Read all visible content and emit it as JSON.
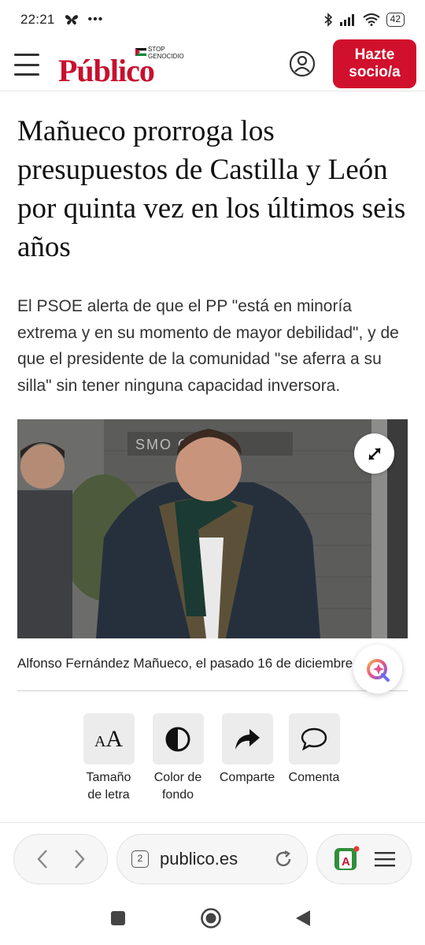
{
  "status_bar": {
    "time": "22:21",
    "battery": "42"
  },
  "header": {
    "brand": "Público",
    "stop_badge_line1": "STOP",
    "stop_badge_line2": "GENOCIDIO",
    "cta_line1": "Hazte",
    "cta_line2": "socio/a",
    "accent_color": "#d0102c"
  },
  "article": {
    "headline": "Mañueco prorroga los presupuestos de Castilla y León por quinta vez en los últimos seis años",
    "subtitle": "El PSOE alerta de que el PP \"está en minoría extrema y en su momento de mayor debilidad\", y de que el presidente de la comunidad \"se aferra a su silla\" sin tener ninguna capacidad inversora.",
    "photo_sign": "SMO   OOM",
    "caption": "Alfonso Fernández Mañueco, el pasado 16 de diciembre"
  },
  "actions": [
    {
      "label_line1": "Tamaño",
      "label_line2": "de letra",
      "icon": "text-size-icon"
    },
    {
      "label_line1": "Color de",
      "label_line2": "fondo",
      "icon": "contrast-icon"
    },
    {
      "label_line1": "Comparte",
      "label_line2": "",
      "icon": "share-arrow-icon"
    },
    {
      "label_line1": "Comenta",
      "label_line2": "",
      "icon": "comment-bubble-icon"
    }
  ],
  "browser": {
    "tab_count": "2",
    "url": "publico.es"
  }
}
